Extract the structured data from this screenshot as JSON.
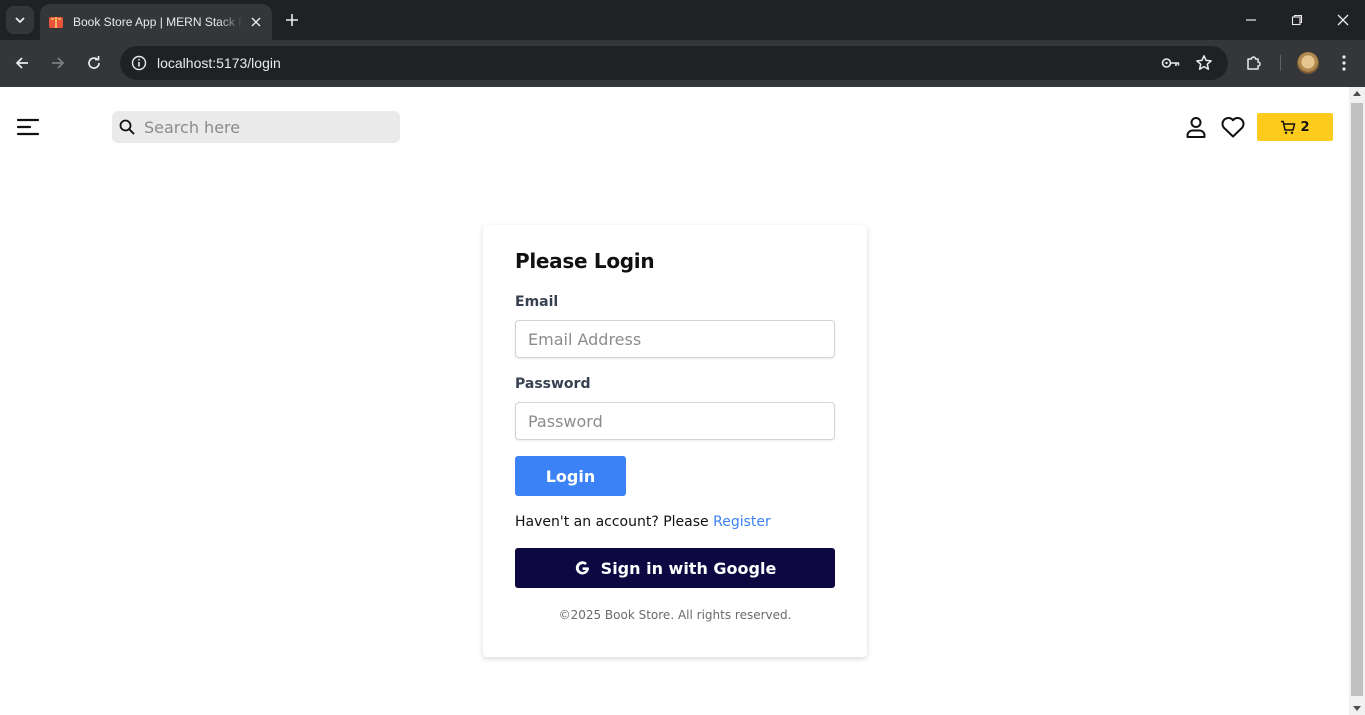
{
  "browser": {
    "tab_title": "Book Store App | MERN Stack Project",
    "url": "localhost:5173/login"
  },
  "header": {
    "search_placeholder": "Search here",
    "cart_count": "2",
    "cart_color": "#fccb1c"
  },
  "login": {
    "title": "Please Login",
    "email_label": "Email",
    "email_placeholder": "Email Address",
    "password_label": "Password",
    "password_placeholder": "Password",
    "login_button": "Login",
    "register_prompt": "Haven't an account? Please ",
    "register_link": "Register",
    "google_button": "Sign in with Google",
    "footer": "©2025 Book Store. All rights reserved.",
    "primary_color": "#3b82f6",
    "google_button_color": "#0d0842"
  },
  "icons": {
    "browser": [
      "tab-list-icon",
      "book-favicon",
      "close-icon",
      "plus-icon",
      "minimize-icon",
      "restore-icon",
      "close-window-icon",
      "back-icon",
      "forward-icon",
      "reload-icon",
      "info-icon",
      "key-icon",
      "star-icon",
      "extensions-icon",
      "kebab-menu-icon"
    ],
    "page": [
      "hamburger-icon",
      "search-icon",
      "user-icon",
      "heart-icon",
      "cart-icon",
      "google-icon"
    ]
  }
}
